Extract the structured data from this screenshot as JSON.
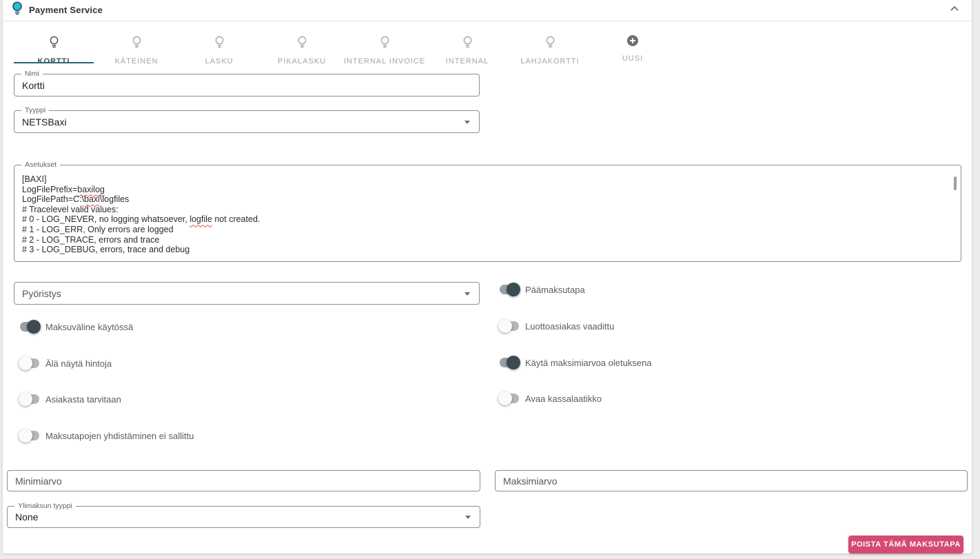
{
  "header": {
    "title": "Payment Service",
    "icon": "lightbulb-icon",
    "collapse_icon": "chevron-up-icon"
  },
  "tabs": [
    {
      "label": "KORTTI",
      "icon": "lightbulb",
      "active": true
    },
    {
      "label": "KÄTEINEN",
      "icon": "lightbulb",
      "active": false
    },
    {
      "label": "LASKU",
      "icon": "lightbulb",
      "active": false
    },
    {
      "label": "PIKALASKU",
      "icon": "lightbulb",
      "active": false
    },
    {
      "label": "INTERNAL INVOICE",
      "icon": "lightbulb",
      "active": false
    },
    {
      "label": "INTERNAL",
      "icon": "lightbulb",
      "active": false
    },
    {
      "label": "LAHJAKORTTI",
      "icon": "lightbulb",
      "active": false
    },
    {
      "label": "UUSI",
      "icon": "plus-circle",
      "active": false
    }
  ],
  "form": {
    "nimi": {
      "label": "Nimi",
      "value": "Kortti"
    },
    "tyyppi": {
      "label": "Tyyppi",
      "value": "NETSBaxi"
    },
    "asetukset": {
      "label": "Asetukset",
      "lines": [
        "[BAXI]",
        "LogFilePrefix=baxilog",
        "LogFilePath=C:\\baxi\\logfiles",
        "# Tracelevel valid values:",
        "# 0 - LOG_NEVER, no logging whatsoever, logfile not created.",
        "# 1 - LOG_ERR, Only errors are logged",
        "# 2 - LOG_TRACE, errors and trace",
        "# 3 - LOG_DEBUG, errors, trace and debug"
      ],
      "misspelled_words": [
        "baxilog",
        "logfile",
        "baxi"
      ]
    },
    "pyoristys": {
      "placeholder": "Pyöristys"
    },
    "toggles_left": [
      {
        "label": "Maksuväline käytössä",
        "on": true
      },
      {
        "label": "Älä näytä hintoja",
        "on": false
      },
      {
        "label": "Asiakasta tarvitaan",
        "on": false
      },
      {
        "label": "Maksutapojen yhdistäminen ei sallittu",
        "on": false
      }
    ],
    "toggles_right": [
      {
        "label": "Päämaksutapa",
        "on": true
      },
      {
        "label": "Luottoasiakas vaadittu",
        "on": false
      },
      {
        "label": "Käytä maksimiarvoa oletuksena",
        "on": true
      },
      {
        "label": "Avaa kassalaatikko",
        "on": false
      }
    ],
    "minimiarvo": {
      "placeholder": "Minimiarvo"
    },
    "maksimiarvo": {
      "placeholder": "Maksimiarvo"
    },
    "ylimaksun_tyyppi": {
      "label": "Ylimaksun tyyppi",
      "value": "None"
    }
  },
  "actions": {
    "delete_button": "POISTA TÄMÄ MAKSUTAPA"
  },
  "colors": {
    "accent_teal": "#2a6876",
    "header_bulb_fill": "#2fb9dc",
    "delete_button": "#d44a72",
    "toggle_on_thumb": "#3c4a52",
    "spellcheck_red": "#e05252"
  }
}
